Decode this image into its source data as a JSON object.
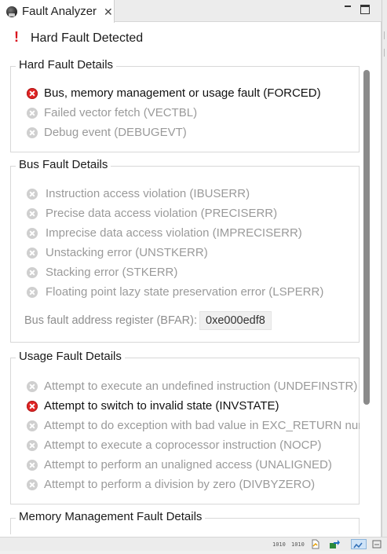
{
  "tab": {
    "title": "Fault Analyzer",
    "close_glyph": "✕"
  },
  "header": {
    "alert_glyph": "!",
    "title": "Hard Fault Detected"
  },
  "hard_fault": {
    "title": "Hard Fault Details",
    "items": [
      {
        "label": "Bus, memory management or usage fault (FORCED)",
        "active": true
      },
      {
        "label": "Failed vector fetch (VECTBL)",
        "active": false
      },
      {
        "label": "Debug event (DEBUGEVT)",
        "active": false
      }
    ]
  },
  "bus_fault": {
    "title": "Bus Fault Details",
    "items": [
      {
        "label": "Instruction access violation (IBUSERR)",
        "active": false
      },
      {
        "label": "Precise data access violation (PRECISERR)",
        "active": false
      },
      {
        "label": "Imprecise data access violation (IMPRECISERR)",
        "active": false
      },
      {
        "label": "Unstacking error (UNSTKERR)",
        "active": false
      },
      {
        "label": "Stacking error (STKERR)",
        "active": false
      },
      {
        "label": "Floating point lazy state preservation error (LSPERR)",
        "active": false
      }
    ],
    "bfar_label": "Bus fault address register (BFAR):",
    "bfar_value": "0xe000edf8"
  },
  "usage_fault": {
    "title": "Usage Fault Details",
    "items": [
      {
        "label": "Attempt to execute an undefined instruction (UNDEFINSTR)",
        "active": false
      },
      {
        "label": "Attempt to switch to invalid state (INVSTATE)",
        "active": true
      },
      {
        "label": "Attempt to do exception with bad value in EXC_RETURN num",
        "active": false
      },
      {
        "label": "Attempt to execute a coprocessor instruction (NOCP)",
        "active": false
      },
      {
        "label": "Attempt to perform an unaligned access (UNALIGNED)",
        "active": false
      },
      {
        "label": "Attempt to perform a division by zero (DIVBYZERO)",
        "active": false
      }
    ]
  },
  "mem_fault": {
    "title": "Memory Management Fault Details"
  },
  "statusbar": {
    "item1": "1010",
    "item2": "1010"
  },
  "colors": {
    "active_icon": "#e02424",
    "inactive_icon": "#cfcfcf",
    "alert": "#d9141e"
  }
}
